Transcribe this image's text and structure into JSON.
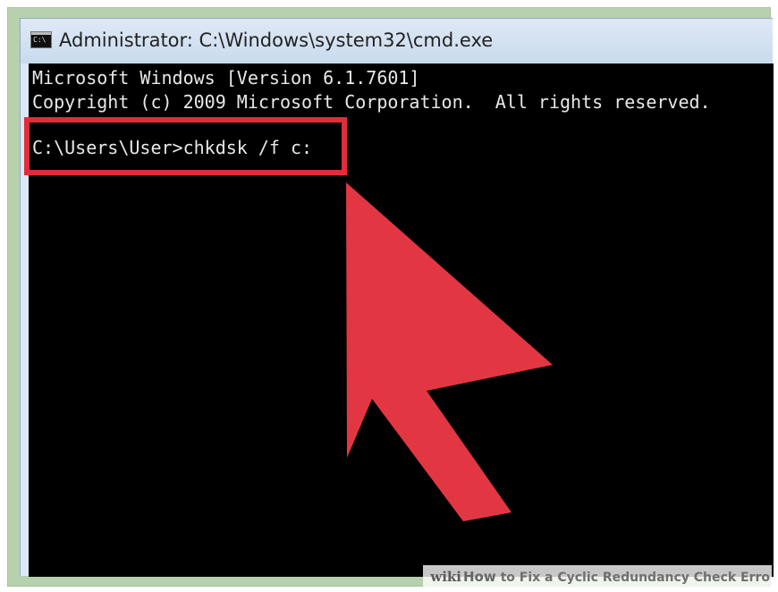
{
  "window": {
    "title": "Administrator: C:\\Windows\\system32\\cmd.exe",
    "icon": "command-prompt-icon"
  },
  "terminal": {
    "lines": [
      "Microsoft Windows [Version 6.1.7601]",
      "Copyright (c) 2009 Microsoft Corporation.  All rights reserved.",
      "C:\\Users\\User>chkdsk /f c:"
    ]
  },
  "annotation": {
    "highlight_color": "#e02d38",
    "arrow_color": "#e23742"
  },
  "watermark": {
    "brand_prefix": "wiki",
    "brand_rest": "How",
    "title": " to Fix a Cyclic Redundancy Check Erro"
  }
}
